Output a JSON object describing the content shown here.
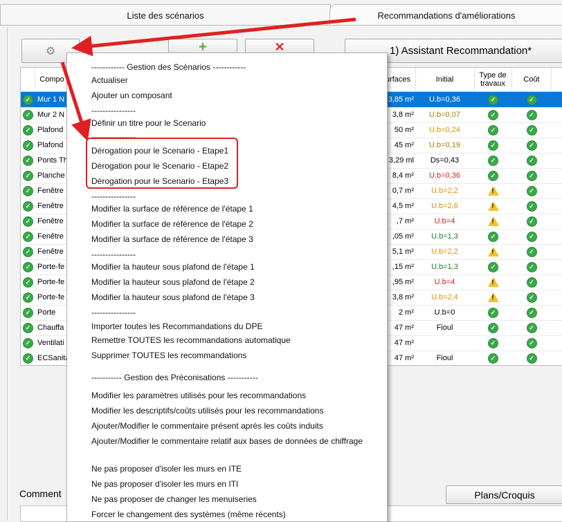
{
  "tabs": [
    {
      "label": "Liste des scénarios"
    },
    {
      "label": "Recommandations d'améliorations"
    }
  ],
  "toolbar": {
    "settings_icon": "gear-icon",
    "add_icon": "plus-icon",
    "delete_icon": "x-icon",
    "assistant_label": "1) Assistant Recommandation*"
  },
  "table": {
    "headers": {
      "composant": "Compo",
      "surfaces": "urfaces",
      "initial": "Initial",
      "type_travaux": "Type de travaux",
      "cout": "Coût"
    },
    "rows": [
      {
        "name": "Mur 1 N",
        "surface": "3,85 m²",
        "initial": "U.b=0,36",
        "color": "#ffffff",
        "type": "ok",
        "cout": "ok"
      },
      {
        "name": "Mur 2 N",
        "surface": "3,8 m²",
        "initial": "U.b=0,07",
        "color": "#a08000",
        "type": "ok",
        "cout": "ok"
      },
      {
        "name": "Plafond",
        "surface": "50 m²",
        "initial": "U.b=0,24",
        "color": "#e09000",
        "type": "ok",
        "cout": "ok"
      },
      {
        "name": "Plafond",
        "surface": "45 m²",
        "initial": "U.b=0,19",
        "color": "#a08000",
        "type": "ok",
        "cout": "ok"
      },
      {
        "name": "Ponts Th",
        "surface": "3,29 ml",
        "initial": "Ds=0,43",
        "color": "#000000",
        "type": "ok",
        "cout": "ok"
      },
      {
        "name": "Planche",
        "surface": "8,4 m²",
        "initial": "U.b=0,36",
        "color": "#d02020",
        "type": "ok",
        "cout": "ok"
      },
      {
        "name": "Fenêtre",
        "surface": "0,7 m²",
        "initial": "U.b=2,2",
        "color": "#e09000",
        "type": "warn",
        "cout": "ok"
      },
      {
        "name": "Fenêtre",
        "surface": "4,5 m²",
        "initial": "U.b=2,6",
        "color": "#e09000",
        "type": "warn",
        "cout": "ok"
      },
      {
        "name": "Fenêtre",
        "surface": ",7 m²",
        "initial": "U.b=4",
        "color": "#d02020",
        "type": "warn",
        "cout": "ok"
      },
      {
        "name": "Fenêtre",
        "surface": ",05 m²",
        "initial": "U.b=1,3",
        "color": "#208020",
        "type": "ok",
        "cout": "ok"
      },
      {
        "name": "Fenêtre",
        "surface": "5,1 m²",
        "initial": "U.b=2,2",
        "color": "#e09000",
        "type": "warn",
        "cout": "ok"
      },
      {
        "name": "Porte-fe",
        "surface": ",15 m²",
        "initial": "U.b=1,3",
        "color": "#208020",
        "type": "ok",
        "cout": "ok"
      },
      {
        "name": "Porte-fe",
        "surface": ",95 m²",
        "initial": "U.b=4",
        "color": "#d02020",
        "type": "warn",
        "cout": "ok"
      },
      {
        "name": "Porte-fe",
        "surface": "3,8 m²",
        "initial": "U.b=2,4",
        "color": "#e09000",
        "type": "warn",
        "cout": "ok"
      },
      {
        "name": "Porte",
        "surface": "2 m²",
        "initial": "U.b=0",
        "color": "#000000",
        "type": "ok",
        "cout": "ok"
      },
      {
        "name": "Chauffa",
        "surface": "47 m²",
        "initial": "Fioul",
        "color": "#000000",
        "type": "ok",
        "cout": "ok"
      },
      {
        "name": "Ventilati",
        "surface": "47 m²",
        "initial": "",
        "color": "#000000",
        "type": "ok",
        "cout": "ok"
      },
      {
        "name": "ECSanita",
        "surface": "47 m²",
        "initial": "Fioul",
        "color": "#000000",
        "type": "ok",
        "cout": "ok"
      }
    ]
  },
  "bottom": {
    "comment_label": "Comment",
    "plans_button": "Plans/Croquis"
  },
  "menu": {
    "items": [
      {
        "label": "------------ Gestion des Scénarios ------------",
        "kind": "header"
      },
      {
        "label": "Actualiser",
        "kind": "item"
      },
      {
        "label": "Ajouter un composant",
        "kind": "item"
      },
      {
        "label": "----------------",
        "kind": "sep"
      },
      {
        "label": "Définir un titre pour le Scenario",
        "kind": "item"
      },
      {
        "label": "----------------",
        "kind": "sep"
      },
      {
        "label": "Dérogation pour le Scenario - Etape1",
        "kind": "item"
      },
      {
        "label": "Dérogation pour le Scenario - Etape2",
        "kind": "item"
      },
      {
        "label": "Dérogation pour le Scenario - Etape3",
        "kind": "item"
      },
      {
        "label": "----------------",
        "kind": "sep"
      },
      {
        "label": "Modifier la surface de référence de l'étape 1",
        "kind": "item"
      },
      {
        "label": "Modifier la surface de référence de l'étape 2",
        "kind": "item"
      },
      {
        "label": "Modifier la surface de référence de l'étape 3",
        "kind": "item"
      },
      {
        "label": "----------------",
        "kind": "sep"
      },
      {
        "label": "Modifier la hauteur sous plafond de l'étape 1",
        "kind": "item"
      },
      {
        "label": "Modifier la hauteur sous plafond de l'étape 2",
        "kind": "item"
      },
      {
        "label": "Modifier la hauteur sous plafond de l'étape 3",
        "kind": "item"
      },
      {
        "label": "----------------",
        "kind": "sep"
      },
      {
        "label": "Importer toutes les Recommandations du DPE",
        "kind": "item"
      },
      {
        "label": "Remettre TOUTES les recommandations automatique",
        "kind": "item"
      },
      {
        "label": "Supprimer TOUTES les recommandations",
        "kind": "item"
      },
      {
        "label": "----------- Gestion des Préconisations -----------",
        "kind": "header"
      },
      {
        "label": "Modifier les paramètres utilisés pour les recommandations",
        "kind": "item"
      },
      {
        "label": "Modifier les descriptifs/coûts utilisés pour les recommandations",
        "kind": "item"
      },
      {
        "label": "Ajouter/Modifier le commentaire présent après les coûts induits",
        "kind": "item"
      },
      {
        "label": "Ajouter/Modifier le commentaire relatif aux bases de données de chiffrage",
        "kind": "item"
      },
      {
        "label": "Ne pas proposer d'isoler les murs en ITE",
        "kind": "item"
      },
      {
        "label": "Ne pas proposer d'isoler les murs en ITI",
        "kind": "item"
      },
      {
        "label": "Ne pas proposer de changer les menuiseries",
        "kind": "item"
      },
      {
        "label": "Forcer le changement des systèmes (même récents)",
        "kind": "item"
      }
    ]
  },
  "colors": {
    "selection": "#0a78d7",
    "annotation": "#e02020",
    "ok": "#3aa94a",
    "warn": "#f1c232"
  }
}
